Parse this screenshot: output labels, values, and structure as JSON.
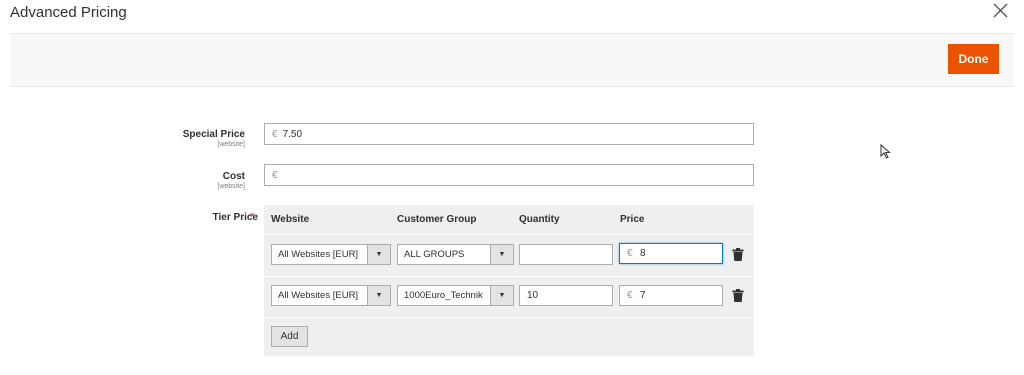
{
  "modal": {
    "title": "Advanced Pricing",
    "done_label": "Done"
  },
  "fields": {
    "special_price": {
      "label": "Special Price",
      "scope": "[website]",
      "currency": "€",
      "value": "7.50"
    },
    "cost": {
      "label": "Cost",
      "scope": "[website]",
      "currency": "€",
      "value": ""
    }
  },
  "tier_price": {
    "label": "Tier Price",
    "required_mark": "*",
    "columns": [
      "Website",
      "Customer Group",
      "Quantity",
      "Price"
    ],
    "rows": [
      {
        "website": "All Websites [EUR]",
        "group": "ALL GROUPS",
        "quantity": "",
        "currency": "€",
        "price": "8"
      },
      {
        "website": "All Websites [EUR]",
        "group": "1000Euro_Technik",
        "quantity": "10",
        "currency": "€",
        "price": "7"
      }
    ],
    "add_label": "Add"
  },
  "icons": {
    "close": "close-icon",
    "trash": "trash-icon",
    "select_arrow": "chevron-down-icon",
    "cursor": "mouse-pointer-icon"
  },
  "colors": {
    "accent": "#eb5202",
    "required": "#e22626",
    "focus": "#007bdb"
  }
}
